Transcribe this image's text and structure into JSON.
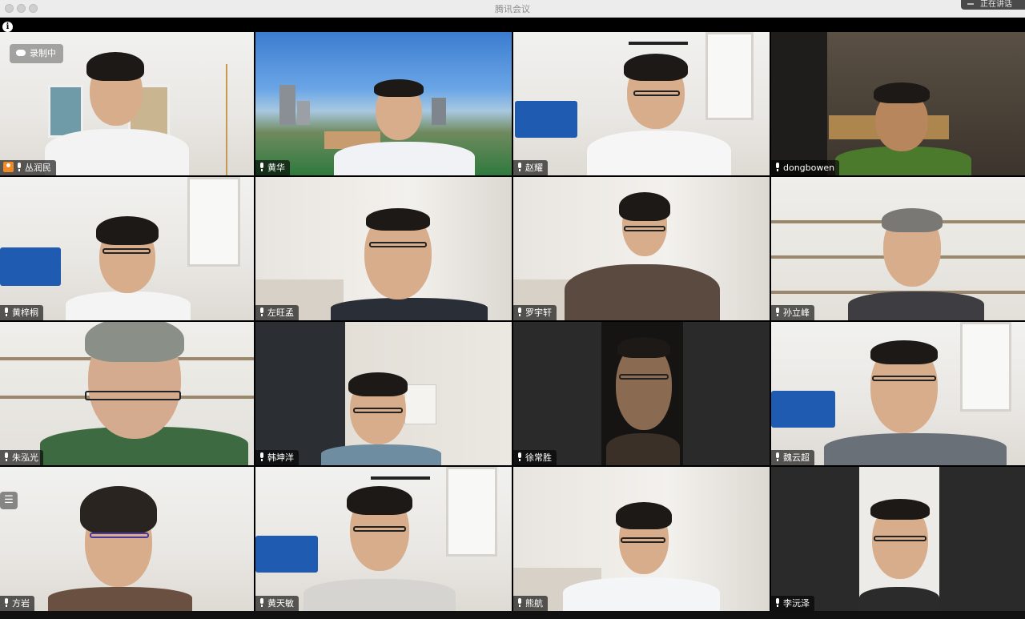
{
  "window": {
    "title": "腾讯会议",
    "top_right_label": "正在讲话"
  },
  "recording": {
    "label": "录制中"
  },
  "colors": {
    "active_speaker_border": "#3fcf6a",
    "host_badge": "#f08a24",
    "name_tag_bg": "rgba(0,0,0,0.62)"
  },
  "participants": [
    {
      "name": "丛润民",
      "host": true
    },
    {
      "name": "黄华"
    },
    {
      "name": "赵耀",
      "active": true
    },
    {
      "name": "dongbowen"
    },
    {
      "name": "黄梓桐"
    },
    {
      "name": "左旺孟"
    },
    {
      "name": "罗宇轩"
    },
    {
      "name": "孙立峰"
    },
    {
      "name": "朱泓光"
    },
    {
      "name": "韩坤洋"
    },
    {
      "name": "徐常胜"
    },
    {
      "name": "魏云超"
    },
    {
      "name": "方岩"
    },
    {
      "name": "黄天敏"
    },
    {
      "name": "熊航"
    },
    {
      "name": "李沅泽"
    }
  ]
}
